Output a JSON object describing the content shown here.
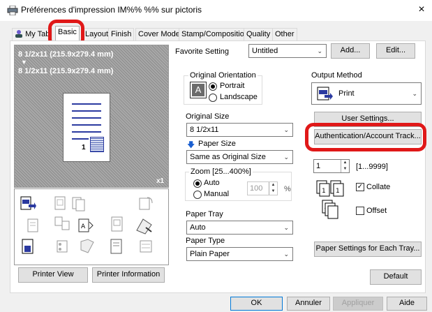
{
  "window": {
    "title": "Préférences d'impression IM%% %% sur pictoris",
    "close": "×"
  },
  "tabs": [
    {
      "label": "My Tab"
    },
    {
      "label": "Basic"
    },
    {
      "label": "Layout"
    },
    {
      "label": "Finish"
    },
    {
      "label": "Cover Mode"
    },
    {
      "label": "Stamp/Composition"
    },
    {
      "label": "Quality"
    },
    {
      "label": "Other"
    }
  ],
  "preview": {
    "line1": "8 1/2x11 (215.9x279.4 mm)",
    "arrow": "▼",
    "line2": "8 1/2x11 (215.9x279.4 mm)",
    "page_number": "1",
    "copies_badge": "x1"
  },
  "left_buttons": {
    "printer_view": "Printer View",
    "printer_information": "Printer Information"
  },
  "favorite": {
    "label": "Favorite Setting",
    "value": "Untitled",
    "add": "Add...",
    "edit": "Edit..."
  },
  "orientation": {
    "label": "Original Orientation",
    "portrait": "Portrait",
    "landscape": "Landscape",
    "selected": "Portrait"
  },
  "original_size": {
    "label": "Original Size",
    "value": "8 1/2x11"
  },
  "paper_size": {
    "label": "Paper Size",
    "value": "Same as Original Size"
  },
  "zoom": {
    "label": "Zoom [25...400%]",
    "auto": "Auto",
    "manual": "Manual",
    "value": "100",
    "unit": "%"
  },
  "paper_tray": {
    "label": "Paper Tray",
    "value": "Auto"
  },
  "paper_type": {
    "label": "Paper Type",
    "value": "Plain Paper"
  },
  "output": {
    "label": "Output Method",
    "value": "Print",
    "user_settings": "User Settings...",
    "auth_button": "Authentication/Account Track...",
    "copies_value": "1",
    "copies_range": "[1...9999]",
    "collate": "Collate",
    "collate_checked": true,
    "offset": "Offset",
    "offset_checked": false,
    "paper_settings_each_tray": "Paper Settings for Each Tray...",
    "default": "Default"
  },
  "footer": {
    "ok": "OK",
    "cancel": "Annuler",
    "apply": "Appliquer",
    "help": "Aide"
  },
  "colors": {
    "highlight": "#e01818",
    "accent_blue": "#0078d7",
    "icon_blue": "#2b3aa0"
  }
}
